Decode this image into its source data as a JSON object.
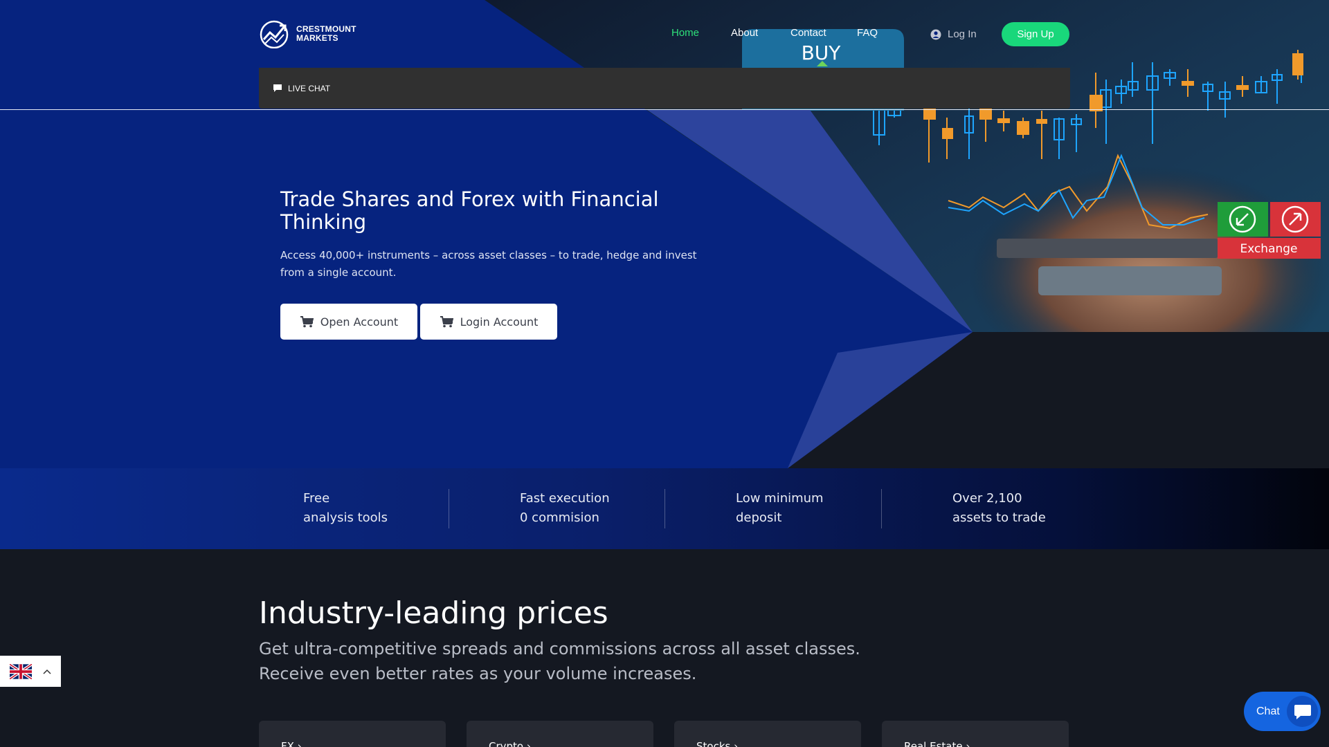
{
  "brand": {
    "line1": "CRESTMOUNT",
    "line2": "MARKETS"
  },
  "nav": {
    "links": [
      {
        "label": "Home",
        "active": true
      },
      {
        "label": "About",
        "active": false
      },
      {
        "label": "Contact",
        "active": false
      },
      {
        "label": "FAQ",
        "active": false
      }
    ],
    "login_label": "Log In",
    "signup_label": "Sign Up"
  },
  "live_chat_bar": {
    "label": "LIVE CHAT",
    "icon": "chat-icon"
  },
  "hero": {
    "title": "Trade Shares and Forex with Financial Thinking",
    "subtitle": "Access 40,000+ instruments – across asset classes – to trade, hedge and invest from a single account.",
    "buttons": [
      {
        "label": "Open Account",
        "icon": "cart-icon"
      },
      {
        "label": "Login Account",
        "icon": "cart-icon"
      }
    ],
    "image": {
      "buy_label": "BUY",
      "exchange_label": "Exchange"
    }
  },
  "features": [
    {
      "line1": "Free",
      "line2": "analysis tools"
    },
    {
      "line1": "Fast execution",
      "line2": "0 commision"
    },
    {
      "line1": "Low minimum",
      "line2": "deposit"
    },
    {
      "line1": "Over 2,100",
      "line2": "assets to trade"
    }
  ],
  "prices": {
    "title": "Industry-leading prices",
    "subtitle_line1": "Get ultra-competitive spreads and commissions across all asset classes.",
    "subtitle_line2": "Receive even better rates as your volume increases.",
    "cards": [
      {
        "label": "FX ›"
      },
      {
        "label": "Crypto ›"
      },
      {
        "label": "Stocks ›"
      },
      {
        "label": "Real Estate ›"
      }
    ]
  },
  "language": {
    "selected": "English (UK)",
    "icon": "uk-flag-icon"
  },
  "chat_widget": {
    "label": "Chat",
    "icon": "chat-bubble-icon"
  },
  "colors": {
    "hero_blue": "#06237f",
    "accent_green": "#19d77b",
    "page_bg": "#141821"
  }
}
